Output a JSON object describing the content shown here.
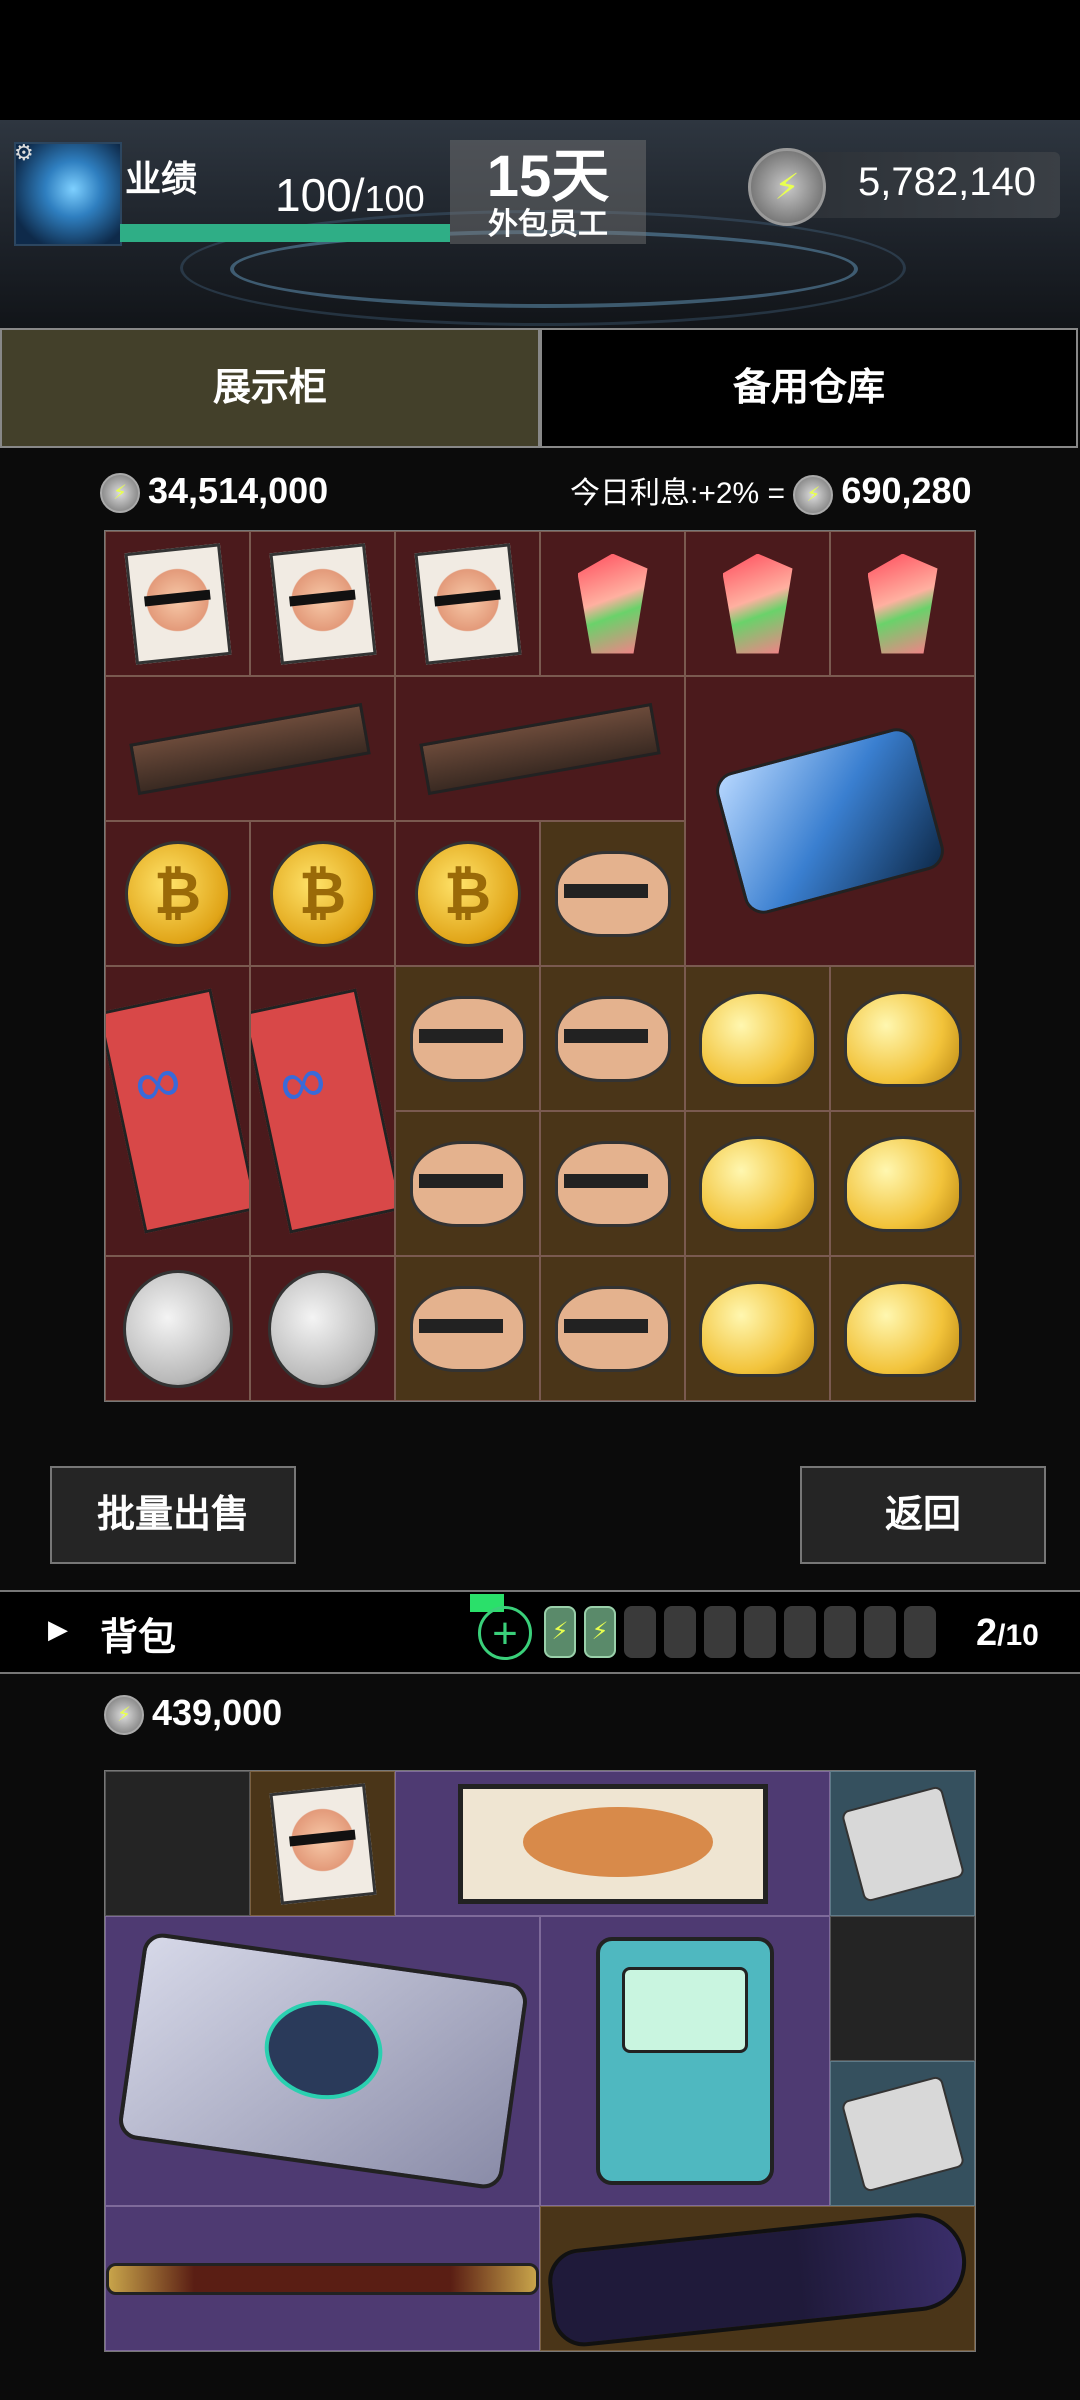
{
  "header": {
    "performance_label": "业绩",
    "performance_value": "100",
    "performance_max": "100",
    "performance_fraction": 1.0,
    "days": "15天",
    "role": "外包员工",
    "money": "5,782,140"
  },
  "tabs": [
    {
      "label": "展示柜",
      "active": true
    },
    {
      "label": "备用仓库",
      "active": false
    }
  ],
  "showcase": {
    "total": "34,514,000",
    "interest_label": "今日利息:+2% =",
    "interest_value": "690,280"
  },
  "buttons": {
    "bulk_sell": "批量出售",
    "back": "返回"
  },
  "backpack": {
    "title": "背包",
    "count": "2",
    "capacity": "/10",
    "total": "439,000"
  },
  "colors": {
    "cell_red": "#4b1a1c",
    "cell_brown": "#4a3518",
    "cell_purple": "#4e3a72",
    "cell_blue": "#35505e",
    "accent_green": "#2fae86"
  },
  "icons": {
    "currency": "lightning-coin-icon",
    "settings": "gear-icon",
    "expand": "triangle-right-icon",
    "add": "plus-circle-icon"
  }
}
